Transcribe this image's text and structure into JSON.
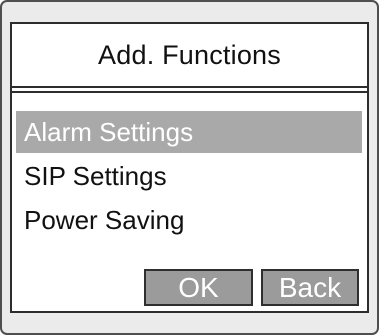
{
  "screen": {
    "title": "Add. Functions"
  },
  "menu": {
    "items": [
      {
        "label": "Alarm Settings",
        "selected": true
      },
      {
        "label": "SIP Settings",
        "selected": false
      },
      {
        "label": "Power Saving",
        "selected": false
      }
    ]
  },
  "softkeys": {
    "ok": "OK",
    "back": "Back"
  },
  "colors": {
    "selected_background": "#a9a9a9",
    "button_background": "#9b9b9b",
    "border": "#2d2d2d",
    "text": "#111111"
  }
}
